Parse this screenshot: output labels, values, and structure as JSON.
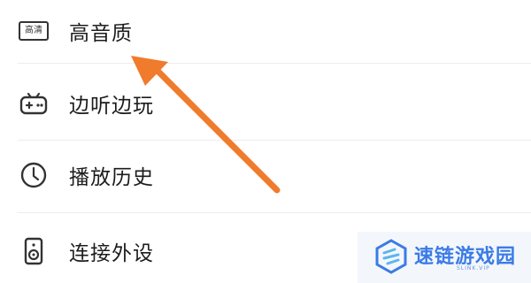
{
  "menu": {
    "items": [
      {
        "label": "高音质",
        "icon": "hq-badge-icon",
        "badge": "高清"
      },
      {
        "label": "边听边玩",
        "icon": "gamepad-icon"
      },
      {
        "label": "播放历史",
        "icon": "clock-icon"
      },
      {
        "label": "连接外设",
        "icon": "speaker-icon"
      }
    ]
  },
  "annotation": {
    "arrow_color": "#f07b2c",
    "icon": "arrow-icon"
  },
  "watermark": {
    "text": "速链游戏园",
    "sub": "SLINK.VIP",
    "color": "#3b7be6"
  }
}
